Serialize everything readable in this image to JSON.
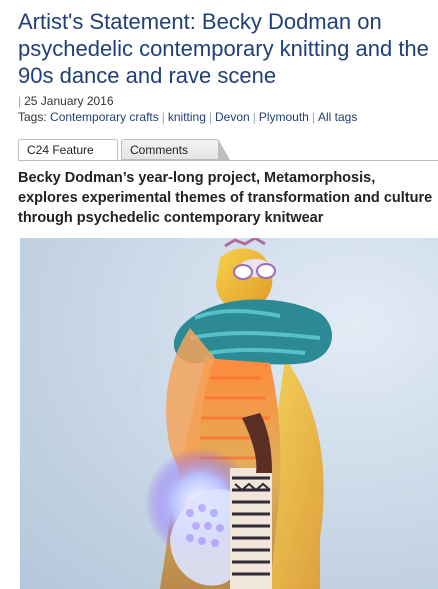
{
  "article": {
    "title": "Artist's Statement: Becky Dodman on psychedelic contemporary knitting and the 90s dance and rave scene",
    "date": "25 January 2016",
    "tags_label": "Tags:",
    "tags": [
      "Contemporary crafts",
      "knitting",
      "Devon",
      "Plymouth",
      "All tags"
    ],
    "standfirst": "Becky Dodman’s year-long project, Metamorphosis, explores experimental themes of transformation and culture through psychedelic contemporary knitwear"
  },
  "tabs": [
    {
      "label": "C24 Feature",
      "active": true
    },
    {
      "label": "Comments",
      "active": false
    }
  ],
  "colors": {
    "title": "#1f3f78",
    "link": "#1f3f78",
    "separator": "#9aa3b5"
  },
  "image": {
    "icon": "photo-knitwear-figure"
  }
}
